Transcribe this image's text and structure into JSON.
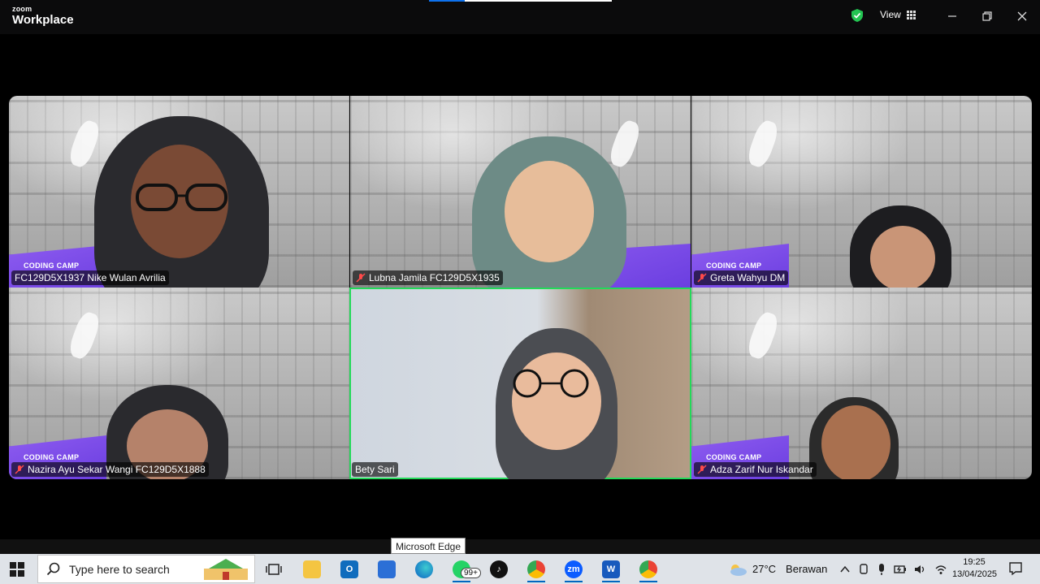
{
  "app": {
    "logo_top": "zoom",
    "logo_bottom": "Workplace"
  },
  "header": {
    "view_label": "View"
  },
  "participants": [
    {
      "name": "FC129D5X1937 Nike Wulan Avrilia",
      "muted": false
    },
    {
      "name": "Lubna Jamila FC129D5X1935",
      "muted": true
    },
    {
      "name": "Greta Wahyu DM",
      "muted": true
    },
    {
      "name": "Nazira Ayu Sekar Wangi FC129D5X1888",
      "muted": true
    },
    {
      "name": "Bety Sari",
      "muted": false,
      "active_speaker": true
    },
    {
      "name": "Adza Zarif Nur Iskandar",
      "muted": true
    }
  ],
  "background_banner": "CODING CAMP",
  "tooltip": "Microsoft Edge",
  "taskbar": {
    "search_placeholder": "Type here to search",
    "whatsapp_badge": "99+",
    "zoom_label": "zm",
    "weather": {
      "temp": "27°C",
      "desc": "Berawan"
    },
    "time": "19:25",
    "date": "13/04/2025"
  },
  "colors": {
    "active_border": "#23d959",
    "banner": "#7c4ee8",
    "taskbar": "#dfe3e8"
  }
}
